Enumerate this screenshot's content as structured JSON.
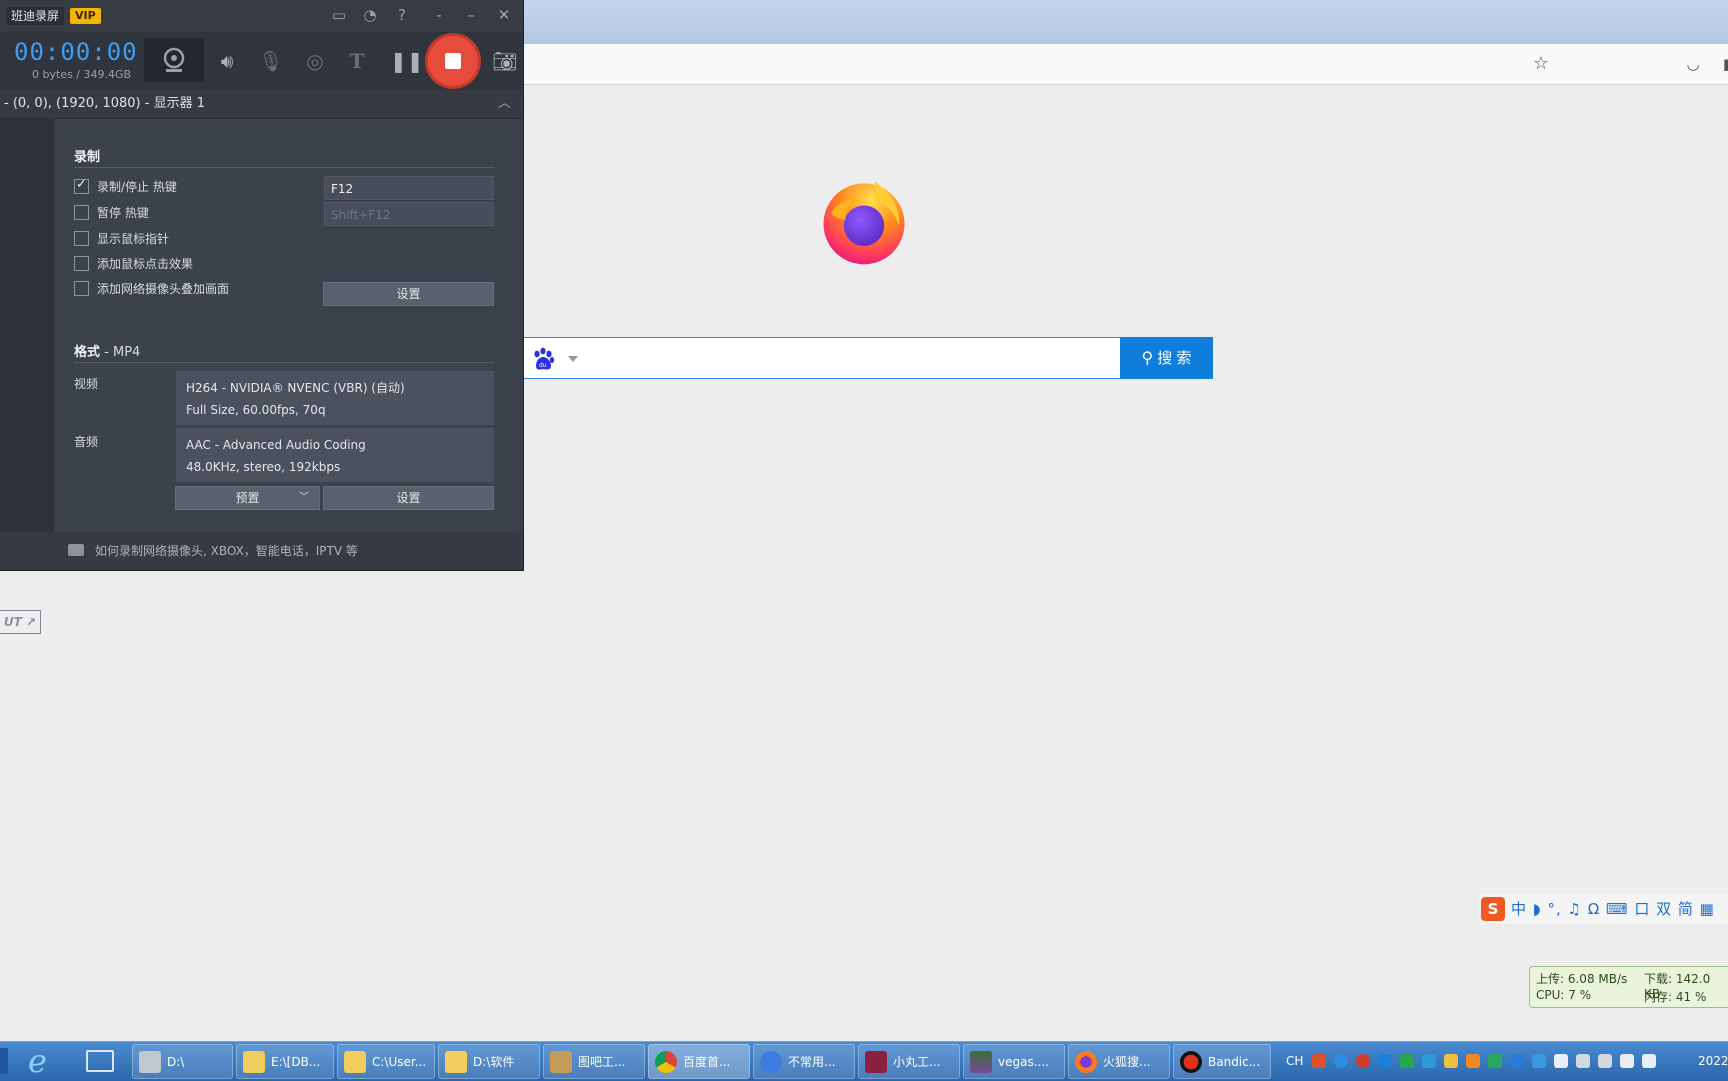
{
  "bandicam": {
    "app_name": "班迪录屏",
    "vip": "VIP",
    "window_icons": {
      "folder": "folder-icon",
      "history": "clock-icon",
      "help": "?",
      "minimize": "-",
      "minimize2": "–",
      "close": "✕"
    },
    "timer": "00:00:00",
    "storage": "0 bytes / 349.4GB",
    "target": "- (0, 0), (1920, 1080) - 显示器 1",
    "side_button": "UT",
    "record_section": {
      "title": "录制",
      "opt_hotkey": "录制/停止 热键",
      "opt_pause": "暂停 热键",
      "opt_cursor": "显示鼠标指针",
      "opt_click": "添加鼠标点击效果",
      "opt_webcam": "添加网络摄像头叠加画面",
      "hotkey_value": "F12",
      "pause_value": "Shift+F12",
      "settings_button": "设置"
    },
    "format_section": {
      "title": "格式",
      "format_value": " - MP4",
      "video_label": "视频",
      "video_line1": "H264 - NVIDIA® NVENC (VBR) (自动)",
      "video_line2": "Full Size, 60.00fps, 70q",
      "audio_label": "音频",
      "audio_line1": "AAC - Advanced Audio Coding",
      "audio_line2": "48.0KHz, stereo, 192kbps",
      "preset_button": "预置",
      "settings_button": "设置"
    },
    "footer": "如何录制网络摄像头, XBOX，智能电话，IPTV 等"
  },
  "firefox": {
    "search_button": "搜 索"
  },
  "ime": {
    "logo": "S",
    "items": "中 ◗ °, ♫ Ω ⌨ 口 双 简 ▦"
  },
  "netmon": {
    "upload": "上传: 6.08 MB/s",
    "download": "下载: 142.0 KB",
    "cpu": "CPU: 7 %",
    "mem": "内存: 41 %"
  },
  "taskbar": {
    "items": [
      {
        "label": "D:\\"
      },
      {
        "label": "E:\\[DB..."
      },
      {
        "label": "C:\\User..."
      },
      {
        "label": "D:\\软件"
      },
      {
        "label": "图吧工..."
      },
      {
        "label": "百度首..."
      },
      {
        "label": "不常用..."
      },
      {
        "label": "小丸工..."
      },
      {
        "label": "vegas...."
      },
      {
        "label": "火狐搜..."
      },
      {
        "label": "Bandic..."
      }
    ],
    "tray_lang": "CH",
    "clock": "2022"
  },
  "colors": {
    "accent_blue": "#3f9cf0",
    "record_red": "#e64b3c",
    "search_blue": "#0f7ddc"
  }
}
